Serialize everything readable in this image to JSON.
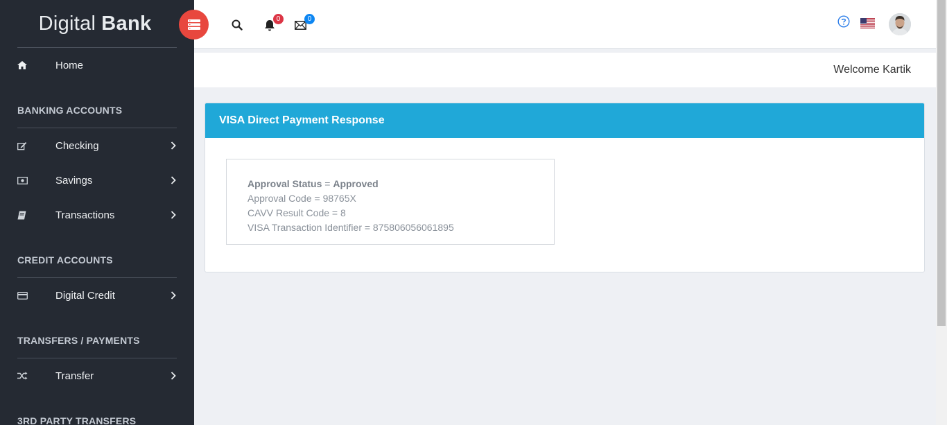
{
  "brand": {
    "light": "Digital",
    "bold": "Bank"
  },
  "sidebar": {
    "home": "Home",
    "sections": {
      "banking": "BANKING ACCOUNTS",
      "credit": "CREDIT ACCOUNTS",
      "transfers": "TRANSFERS / PAYMENTS",
      "third_party": "3RD PARTY TRANSFERS"
    },
    "items": {
      "checking": "Checking",
      "savings": "Savings",
      "transactions": "Transactions",
      "digital_credit": "Digital Credit",
      "transfer": "Transfer"
    }
  },
  "header": {
    "notifications_count": "0",
    "messages_count": "0",
    "welcome": "Welcome Kartik"
  },
  "card": {
    "title": "VISA Direct Payment Response",
    "approval_status_label": "Approval Status",
    "approval_status_value": "Approved",
    "approval_code": "Approval Code = 98765X",
    "cavv_result": "CAVV Result Code = 8",
    "visa_txn_id": "VISA Transaction Identifier = 875806056061895"
  },
  "colors": {
    "sidebar_bg": "#252a33",
    "card_header": "#20a8d8",
    "toggle_button": "#e8473e",
    "badge_red": "#dc3545",
    "badge_blue": "#0d86f2"
  },
  "icons": [
    "home-icon",
    "edit-icon",
    "money-icon",
    "book-icon",
    "credit-card-icon",
    "shuffle-icon",
    "chevron-right-icon",
    "search-icon",
    "bell-icon",
    "envelope-icon",
    "help-icon",
    "us-flag-icon",
    "avatar"
  ]
}
